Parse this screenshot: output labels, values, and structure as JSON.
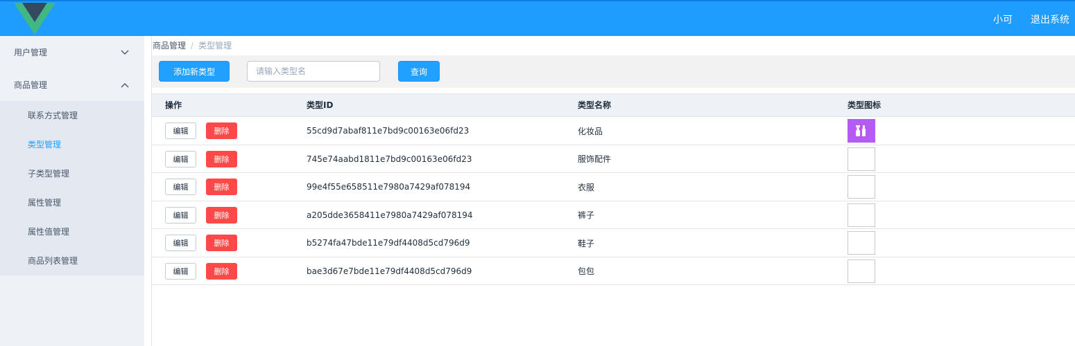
{
  "header": {
    "user_name": "小可",
    "logout_label": "退出系统"
  },
  "sidebar": {
    "groups": [
      {
        "label": "用户管理"
      },
      {
        "label": "商品管理"
      }
    ],
    "submenu": [
      {
        "label": "联系方式管理"
      },
      {
        "label": "类型管理"
      },
      {
        "label": "子类型管理"
      },
      {
        "label": "属性管理"
      },
      {
        "label": "属性值管理"
      },
      {
        "label": "商品列表管理"
      }
    ]
  },
  "breadcrumb": {
    "parent": "商品管理",
    "separator": "/",
    "current": "类型管理"
  },
  "toolbar": {
    "add_label": "添加新类型",
    "search_placeholder": "请输入类型名",
    "search_value": "",
    "query_label": "查询"
  },
  "table": {
    "headers": [
      "操作",
      "类型ID",
      "类型名称",
      "类型图标"
    ],
    "edit_label": "编辑",
    "delete_label": "删除",
    "rows": [
      {
        "id": "55cd9d7abaf811e7bd9c00163e06fd23",
        "name": "化妆品"
      },
      {
        "id": "745e74aabd1811e7bd9c00163e06fd23",
        "name": "服饰配件"
      },
      {
        "id": "99e4f55e658511e7980a7429af078194",
        "name": "衣服"
      },
      {
        "id": "a205dde3658411e7980a7429af078194",
        "name": "裤子"
      },
      {
        "id": "b5274fa47bde11e79df4408d5cd796d9",
        "name": "鞋子"
      },
      {
        "id": "bae3d67e7bde11e79df4408d5cd796d9",
        "name": "包包"
      }
    ]
  },
  "colors": {
    "header_bg": "#1f9dff",
    "primary": "#20a0ff",
    "danger": "#ff4949",
    "icon_purple": "#b55af2"
  },
  "icons": {
    "logo": "vue-logo",
    "group_collapsed": "chevron-down-icon",
    "group_expanded": "chevron-up-icon",
    "type_icon": "cosmetics-icon"
  }
}
